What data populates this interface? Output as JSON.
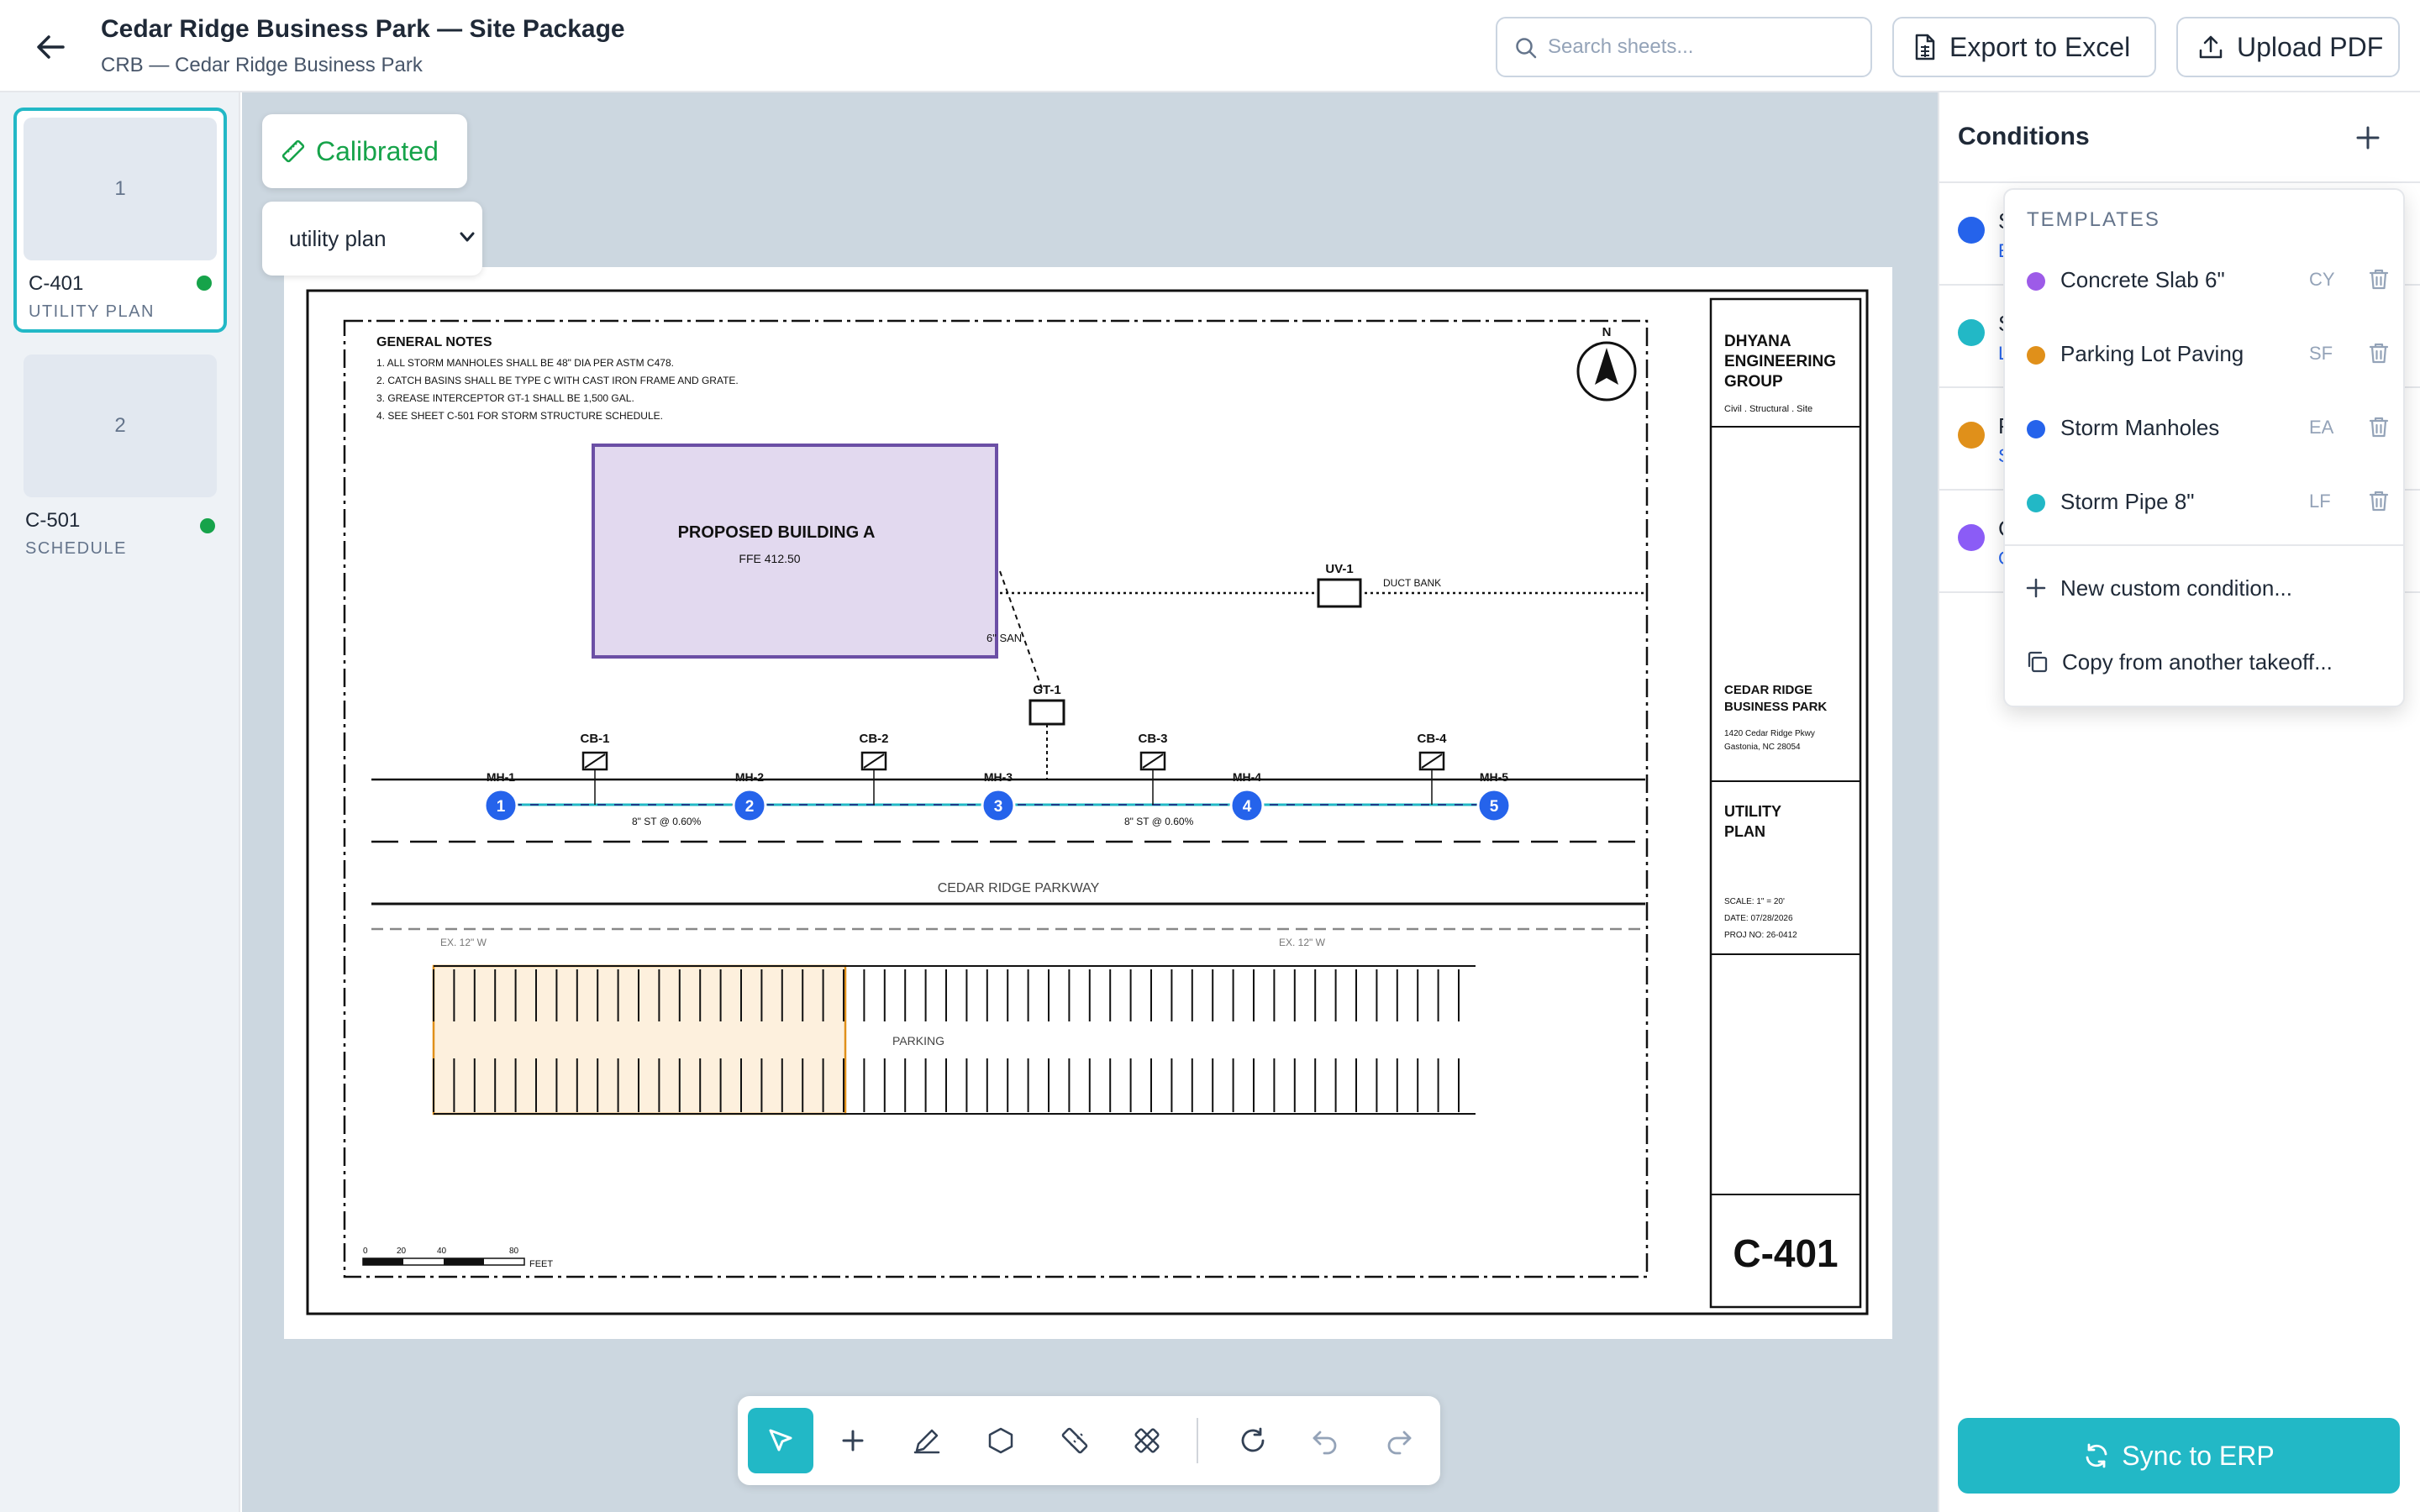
{
  "header": {
    "title": "Cedar Ridge Business Park — Site Package",
    "subtitle": "CRB — Cedar Ridge Business Park",
    "search_placeholder": "Search sheets...",
    "export_label": "Export to Excel",
    "upload_label": "Upload PDF"
  },
  "sheets": [
    {
      "number": "1",
      "code": "C-401",
      "desc": "UTILITY PLAN",
      "status_color": "#16a34a"
    },
    {
      "number": "2",
      "code": "C-501",
      "desc": "SCHEDULE",
      "status_color": "#16a34a"
    }
  ],
  "canvas": {
    "calibrated_label": "Calibrated",
    "sheet_select_value": "utility plan"
  },
  "drawing": {
    "general_notes_title": "GENERAL NOTES",
    "notes": [
      "1. ALL STORM MANHOLES SHALL BE 48\" DIA PER ASTM C478.",
      "2. CATCH BASINS SHALL BE TYPE C WITH CAST IRON FRAME AND GRATE.",
      "3. GREASE INTERCEPTOR GT-1 SHALL BE 1,500 GAL.",
      "4. SEE SHEET C-501 FOR STORM STRUCTURE SCHEDULE."
    ],
    "north": "N",
    "building_title": "PROPOSED BUILDING A",
    "building_ffe": "FFE 412.50",
    "san_label": "6\" SAN",
    "uv_label": "UV-1",
    "duct_label": "DUCT BANK",
    "gt_label": "GT-1",
    "catch_basins": [
      "CB-1",
      "CB-2",
      "CB-3",
      "CB-4"
    ],
    "manhole_labels": [
      "MH-1",
      "MH-2",
      "MH-3",
      "MH-4",
      "MH-5"
    ],
    "manhole_numbers": [
      "1",
      "2",
      "3",
      "4",
      "5"
    ],
    "pipe_labels": [
      "8\" ST @ 0.60%",
      "8\" ST @ 0.60%"
    ],
    "street_name": "CEDAR RIDGE PARKWAY",
    "water_labels": [
      "EX. 12\" W",
      "EX. 12\" W"
    ],
    "parking_label": "PARKING",
    "scale_ticks": [
      "0",
      "20",
      "40",
      "80"
    ],
    "scale_unit": "FEET",
    "firm_name": [
      "DHYANA",
      "ENGINEERING",
      "GROUP"
    ],
    "firm_services": "Civil . Structural . Site",
    "project_name": [
      "CEDAR RIDGE",
      "BUSINESS PARK"
    ],
    "project_address": [
      "1420 Cedar Ridge Pkwy",
      "Gastonia, NC 28054"
    ],
    "sheet_title": [
      "UTILITY",
      "PLAN"
    ],
    "sheet_scale": "SCALE: 1\" = 20'",
    "sheet_date": "DATE: 07/28/2026",
    "proj_no": "PROJ NO: 26-0412",
    "sheet_number": "C-401"
  },
  "toolbar": {
    "tools": [
      "select-tool",
      "add-tool",
      "pen-tool",
      "polygon-tool",
      "ruler-tool",
      "calibrate-tool",
      "refresh-tool",
      "undo-tool",
      "redo-tool"
    ]
  },
  "conditions": {
    "title": "Conditions",
    "items": [
      {
        "initial": "S",
        "sub": "E",
        "color": "#2563eb",
        "sub_color": "#2563eb"
      },
      {
        "initial": "S",
        "sub": "L",
        "color": "#22b8c6",
        "sub_color": "#2563eb"
      },
      {
        "initial": "P",
        "sub": "S",
        "color": "#e0901a",
        "sub_color": "#2563eb"
      },
      {
        "initial": "C",
        "sub": "C",
        "color": "#8b5cf6",
        "sub_color": "#2563eb"
      }
    ],
    "sync_label": "Sync to ERP"
  },
  "templates": {
    "heading": "TEMPLATES",
    "items": [
      {
        "name": "Concrete Slab 6\"",
        "unit": "CY",
        "color": "#9d5be8"
      },
      {
        "name": "Parking Lot Paving",
        "unit": "SF",
        "color": "#e0901a"
      },
      {
        "name": "Storm Manholes",
        "unit": "EA",
        "color": "#2563eb"
      },
      {
        "name": "Storm Pipe 8\"",
        "unit": "LF",
        "color": "#22b8c6"
      }
    ],
    "new_custom": "New custom condition...",
    "copy_from": "Copy from another takeoff..."
  },
  "colors": {
    "accent": "#22b8c6",
    "success": "#16a34a",
    "building_fill": "#e2d9ef",
    "building_stroke": "#6b4fa5",
    "manhole": "#2563eb",
    "parking_fill": "#fdf0dd",
    "parking_stroke": "#e0901a"
  }
}
